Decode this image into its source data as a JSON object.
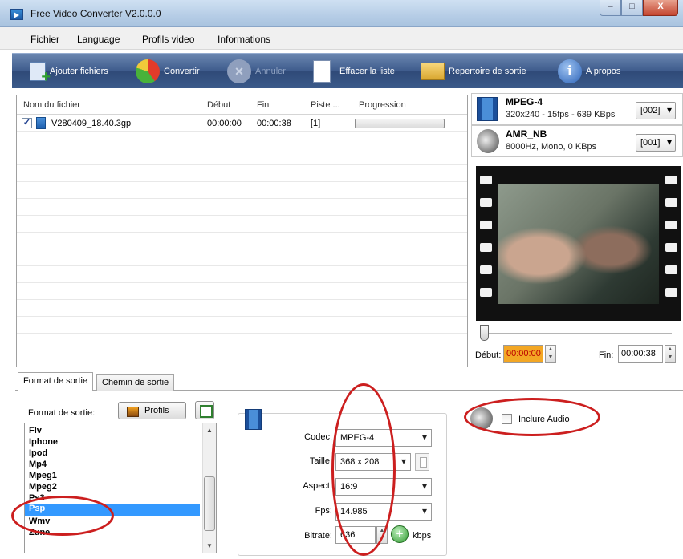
{
  "window": {
    "title": "Free Video Converter V2.0.0.0",
    "controls": {
      "minimize": "–",
      "maximize": "□",
      "close": "X"
    }
  },
  "menu": {
    "items": [
      "Fichier",
      "Language",
      "Profils video",
      "Informations"
    ]
  },
  "toolbar": {
    "add_files": "Ajouter fichiers",
    "convert": "Convertir",
    "cancel": "Annuler",
    "clear_list": "Effacer la liste",
    "output_dir": "Repertoire de sortie",
    "about": "A propos"
  },
  "file_list": {
    "columns": [
      "Nom du fichier",
      "Début",
      "Fin",
      "Piste ...",
      "Progression"
    ],
    "rows": [
      {
        "checked": true,
        "name": "V280409_18.40.3gp",
        "start": "00:00:00",
        "end": "00:00:38",
        "track": "[1]",
        "progress": 0
      }
    ]
  },
  "video_stream": {
    "codec": "MPEG-4",
    "info": "320x240 - 15fps - 639 KBps",
    "index": "[002]"
  },
  "audio_stream": {
    "codec": "AMR_NB",
    "info": "8000Hz, Mono, 0 KBps",
    "index": "[001]"
  },
  "timeline": {
    "start_label": "Début:",
    "start_value": "00:00:00",
    "end_label": "Fin:",
    "end_value": "00:00:38"
  },
  "tabs": [
    "Format de sortie",
    "Chemin de sortie"
  ],
  "output_format": {
    "label": "Format de sortie:",
    "profiles_button": "Profils",
    "formats": [
      "Flv",
      "Iphone",
      "Ipod",
      "Mp4",
      "Mpeg1",
      "Mpeg2",
      "Ps3",
      "Psp",
      "Wmv",
      "Zune"
    ],
    "selected": "Psp"
  },
  "settings": {
    "codec_label": "Codec:",
    "codec": "MPEG-4",
    "size_label": "Taille:",
    "size": "368 x 208",
    "aspect_label": "Aspect:",
    "aspect": "16:9",
    "fps_label": "Fps:",
    "fps": "14.985",
    "bitrate_label": "Bitrate:",
    "bitrate": "636",
    "bitrate_unit": "kbps"
  },
  "audio": {
    "include_label": "Inclure Audio",
    "checked": false
  },
  "colors": {
    "toolbar": "#3e5b8c",
    "selection": "#3399ff",
    "highlight": "#f3a724",
    "annotation": "#cc1f1f"
  }
}
